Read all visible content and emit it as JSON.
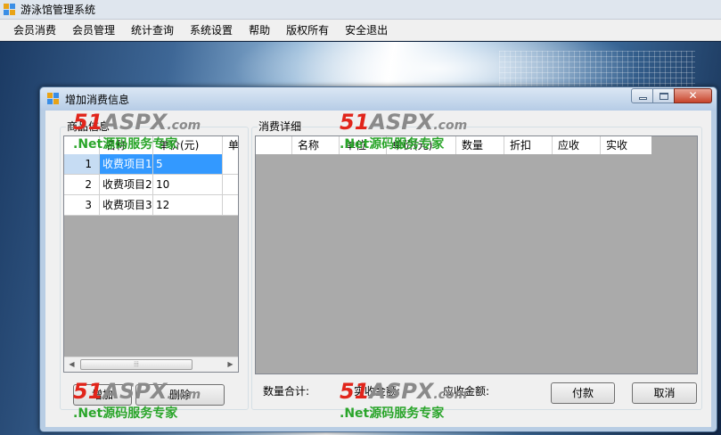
{
  "app": {
    "title": "游泳馆管理系统",
    "menu": [
      "会员消费",
      "会员管理",
      "统计查询",
      "系统设置",
      "帮助",
      "版权所有",
      "安全退出"
    ]
  },
  "dialog": {
    "title": "增加消费信息",
    "close_glyph": "✕",
    "product_group": {
      "label": "商品信息",
      "columns": [
        "名称",
        "单价(元)",
        "单"
      ],
      "rows": [
        {
          "index": "1",
          "name": "收费项目1",
          "price": "5",
          "selected": true
        },
        {
          "index": "2",
          "name": "收费项目2",
          "price": "10",
          "selected": false
        },
        {
          "index": "3",
          "name": "收费项目3",
          "price": "12",
          "selected": false
        }
      ],
      "scroll_thumb_glyph": "⦙⦙⦙"
    },
    "detail_group": {
      "label": "消费详细",
      "columns": [
        "名称",
        "单位",
        "单价(元)",
        "数量",
        "折扣",
        "应收",
        "实收"
      ]
    },
    "buttons": {
      "add": "增加",
      "delete": "删除",
      "pay": "付款",
      "cancel": "取消"
    },
    "summary": {
      "quantity_total": "数量合计:",
      "actual_amount": "实收金额:",
      "receivable_amount": "应收金额:"
    }
  },
  "watermarks": [
    {
      "logo_a": "51",
      "logo_b": "ASPX",
      "logo_c": ".com",
      "sub": ".Net源码服务专家"
    },
    {
      "logo_a": "51",
      "logo_b": "ASPX",
      "logo_c": ".com",
      "sub": ".Net源码服务专家"
    },
    {
      "logo_a": "51",
      "logo_b": "ASPX",
      "logo_c": ".com",
      "sub": ".Net源码服务专家"
    },
    {
      "logo_a": "51",
      "logo_b": "ASPX",
      "logo_c": ".com",
      "sub": ".Net源码服务专家"
    }
  ],
  "colors": {
    "selection": "#3399ff",
    "grid_background": "#aaaaaa",
    "dialog_frame": "#b8cde4"
  },
  "icons": [
    "app-icon",
    "dialog-icon",
    "minimize-icon",
    "maximize-icon",
    "close-icon",
    "scroll-left-icon",
    "scroll-right-icon"
  ]
}
